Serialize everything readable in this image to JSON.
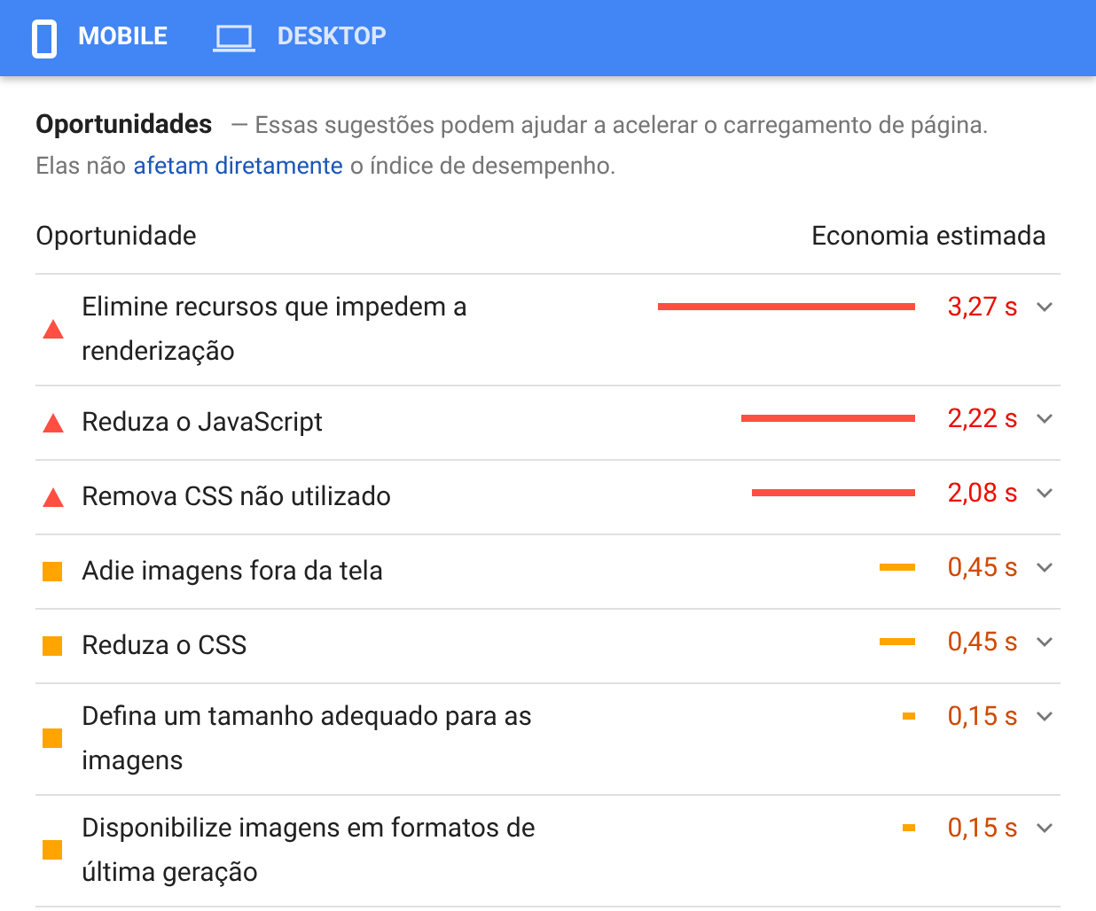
{
  "tabs": [
    {
      "label": "MOBILE",
      "kind": "mobile",
      "selected": true
    },
    {
      "label": "DESKTOP",
      "kind": "desktop",
      "selected": false
    }
  ],
  "section": {
    "title": "Oportunidades",
    "dash": "—",
    "description": "Essas sugestões podem ajudar a acelerar o carregamento de página.",
    "note_before": "Elas não",
    "link": "afetam diretamente",
    "note_after": "o índice de desempenho."
  },
  "columns": [
    "Oportunidade",
    "Economia estimada"
  ],
  "rows": [
    {
      "kind": "fail",
      "label": "Elimine recursos que impedem a renderização",
      "savings": "3,27 s"
    },
    {
      "kind": "fail",
      "label": "Reduza o JavaScript",
      "savings": "2,22 s"
    },
    {
      "kind": "fail",
      "label": "Remova CSS não utilizado",
      "savings": "2,08 s"
    },
    {
      "kind": "average",
      "label": "Adie imagens fora da tela",
      "savings": "0,45 s"
    },
    {
      "kind": "average",
      "label": "Reduza o CSS",
      "savings": "0,45 s"
    },
    {
      "kind": "average",
      "label": "Defina um tamanho adequado para as imagens",
      "savings": "0,15 s"
    },
    {
      "kind": "average",
      "label": "Disponibilize imagens em formatos de última geração",
      "savings": "0,15 s"
    }
  ]
}
